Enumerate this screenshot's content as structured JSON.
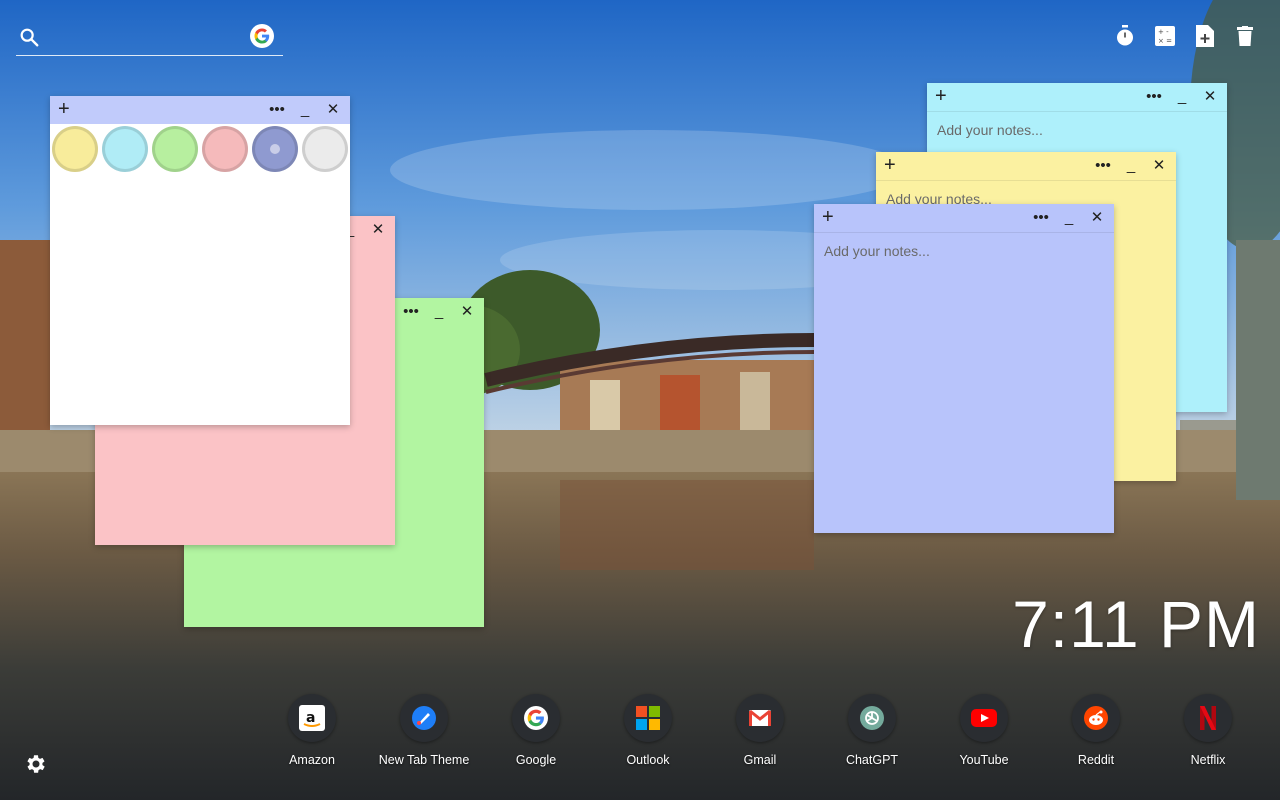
{
  "search": {
    "placeholder": ""
  },
  "toolbar": {
    "items": [
      "timer-icon",
      "calculator-icon",
      "new-note-icon",
      "trash-icon"
    ]
  },
  "note_placeholder": "Add your notes...",
  "colors": {
    "yellow": "#fbf1a1",
    "cyan": "#aef0fb",
    "green": "#b2f5a1",
    "pink": "#fbc3c6",
    "periwinkle": "#b8c4fb",
    "white": "#ffffff",
    "head_periwinkle": "#c1cbfb"
  },
  "swatches": [
    {
      "name": "yellow",
      "color": "#f8ec9b"
    },
    {
      "name": "cyan",
      "color": "#b0ecf6"
    },
    {
      "name": "green",
      "color": "#b7ef9f"
    },
    {
      "name": "pink",
      "color": "#f5babb"
    },
    {
      "name": "periwinkle",
      "color": "#8f9ad0",
      "selected": true
    },
    {
      "name": "white",
      "color": "#ebebeb"
    }
  ],
  "notes": {
    "cyan": {
      "placeholder": "Add your notes..."
    },
    "yellow": {
      "placeholder": "Add your notes..."
    },
    "periwinkle": {
      "placeholder": "Add your notes..."
    }
  },
  "clock": {
    "time": "7:11 PM"
  },
  "dock": [
    {
      "label": "Amazon",
      "icon": "amazon-icon"
    },
    {
      "label": "New Tab Theme",
      "icon": "new-tab-theme-icon"
    },
    {
      "label": "Google",
      "icon": "google-icon"
    },
    {
      "label": "Outlook",
      "icon": "outlook-icon"
    },
    {
      "label": "Gmail",
      "icon": "gmail-icon"
    },
    {
      "label": "ChatGPT",
      "icon": "chatgpt-icon"
    },
    {
      "label": "YouTube",
      "icon": "youtube-icon"
    },
    {
      "label": "Reddit",
      "icon": "reddit-icon"
    },
    {
      "label": "Netflix",
      "icon": "netflix-icon"
    }
  ]
}
